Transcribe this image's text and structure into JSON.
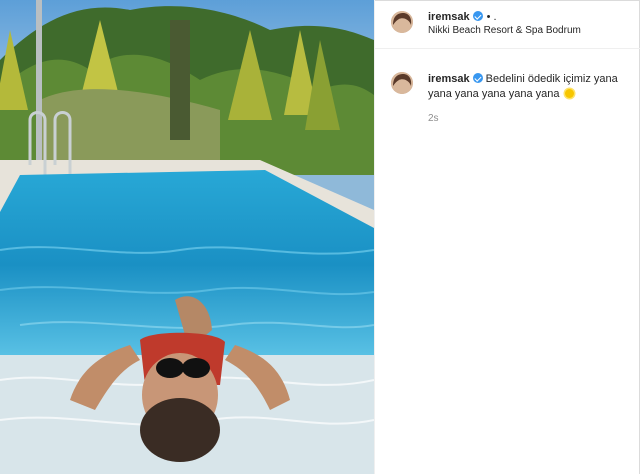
{
  "post": {
    "username": "iremsak",
    "header_suffix": "•  .",
    "location": "Nikki Beach Resort & Spa Bodrum"
  },
  "comment": {
    "username": "iremsak",
    "text": "Bedelini ödedik içimiz yana yana yana yana yana yana",
    "emoji": "sun-emoji",
    "timestamp": "2s"
  },
  "colors": {
    "verified_badge": "#3897f0",
    "timestamp": "#8e8e8e",
    "username": "#262626"
  }
}
